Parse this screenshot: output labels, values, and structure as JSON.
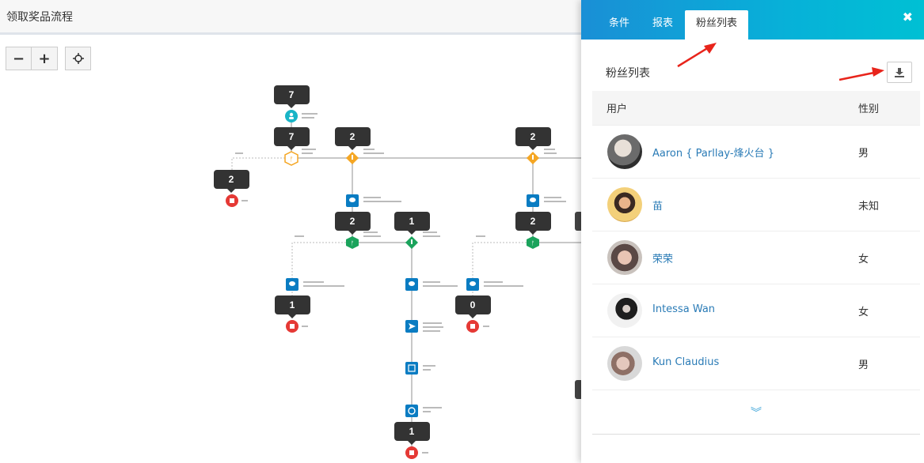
{
  "canvas": {
    "title": "领取奖品流程",
    "zoom_out_icon": "minus-icon",
    "zoom_in_icon": "plus-icon",
    "center_icon": "crosshair-icon"
  },
  "flow": {
    "counts": [
      "7",
      "7",
      "2",
      "2",
      "2",
      "2",
      "1",
      "2",
      "1",
      "0",
      "1"
    ]
  },
  "panel": {
    "tabs": [
      "条件",
      "报表",
      "粉丝列表"
    ],
    "active_tab": "粉丝列表",
    "close_icon": "close-icon",
    "list_title": "粉丝列表",
    "download_icon": "download-icon",
    "columns": {
      "user": "用户",
      "gender": "性别"
    },
    "fans": [
      {
        "name": "Aaron { Parllay-烽火台 }",
        "gender": "男"
      },
      {
        "name": "苗",
        "gender": "未知"
      },
      {
        "name": "荣荣",
        "gender": "女"
      },
      {
        "name": "Intessa Wan",
        "gender": "女"
      },
      {
        "name": "Kun Claudius",
        "gender": "男"
      }
    ],
    "load_more_icon": "double-chevron-down-icon"
  },
  "colors": {
    "panel_gradient_start": "#1a8fd6",
    "panel_gradient_end": "#00c0d4",
    "link": "#2a7bb6",
    "node_blue": "#0a7cc2",
    "node_orange": "#f5a623",
    "node_green": "#1ba35c",
    "node_red": "#e53935",
    "node_teal": "#19b4c6",
    "annotation_arrow": "#e8241b"
  }
}
